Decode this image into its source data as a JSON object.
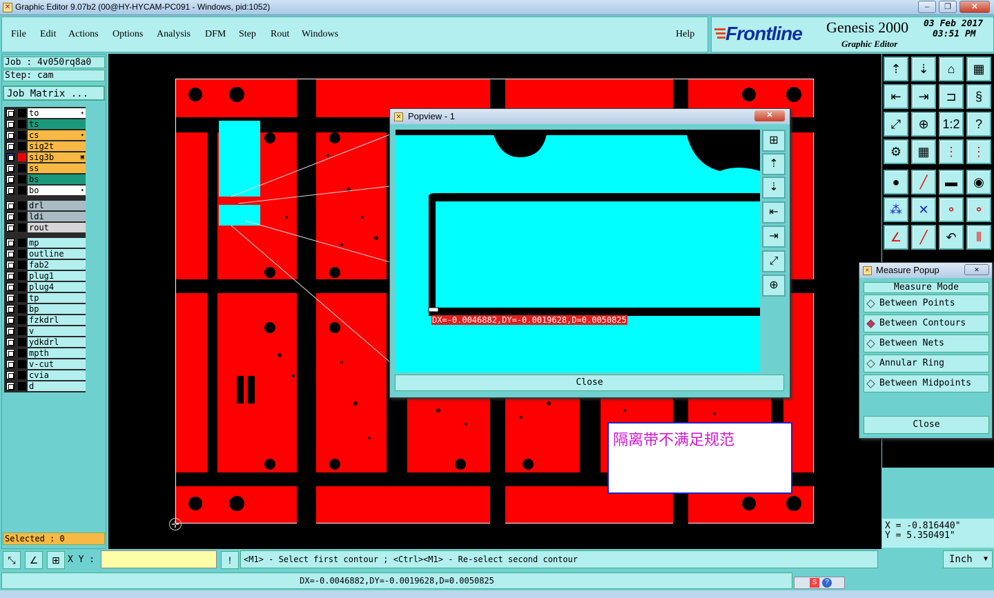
{
  "window": {
    "title": "Graphic Editor 9.07b2 (00@HY-HYCAM-PC091 - Windows, pid:1052)"
  },
  "menu": {
    "items": [
      "File",
      "Edit",
      "Actions",
      "Options",
      "Analysis",
      "DFM",
      "Step",
      "Rout",
      "Windows"
    ],
    "help": "Help"
  },
  "brand": {
    "logo": "Frontline",
    "product": "Genesis 2000",
    "subtitle": "Graphic Editor",
    "date": "03 Feb 2017",
    "time": "03:51 PM"
  },
  "job": {
    "job_label": "Job : 4v050rq8a0",
    "step_label": "Step: cam",
    "matrix_button": "Job Matrix ..."
  },
  "layers": [
    {
      "name": "to",
      "color": "#ffffff",
      "mark": "✦"
    },
    {
      "name": "ts",
      "color": "#1a9a7a",
      "mark": ""
    },
    {
      "name": "cs",
      "color": "#f7b944",
      "mark": "✦"
    },
    {
      "name": "sig2t",
      "color": "#f7b944",
      "mark": ""
    },
    {
      "name": "sig3b",
      "color": "#f7b944",
      "mark": "▣",
      "active": true
    },
    {
      "name": "ss",
      "color": "#f7b944",
      "mark": ""
    },
    {
      "name": "bs",
      "color": "#1a9a7a",
      "mark": ""
    },
    {
      "name": "bo",
      "color": "#ffffff",
      "mark": "✦"
    },
    {
      "name": "drl",
      "color": "#a9bcc4",
      "mark": ""
    },
    {
      "name": "ldi",
      "color": "#a9bcc4",
      "mark": ""
    },
    {
      "name": "rout",
      "color": "#d6d6d6",
      "mark": ""
    },
    {
      "name": "mp",
      "color": "#b3efef",
      "mark": ""
    },
    {
      "name": "outline",
      "color": "#b3efef",
      "mark": ""
    },
    {
      "name": "fab2",
      "color": "#b3efef",
      "mark": ""
    },
    {
      "name": "plug1",
      "color": "#b3efef",
      "mark": ""
    },
    {
      "name": "plug4",
      "color": "#b3efef",
      "mark": ""
    },
    {
      "name": "tp",
      "color": "#b3efef",
      "mark": ""
    },
    {
      "name": "bp",
      "color": "#b3efef",
      "mark": ""
    },
    {
      "name": "fzkdrl",
      "color": "#b3efef",
      "mark": ""
    },
    {
      "name": "v",
      "color": "#b3efef",
      "mark": ""
    },
    {
      "name": "ydkdrl",
      "color": "#b3efef",
      "mark": ""
    },
    {
      "name": "mpth",
      "color": "#b3efef",
      "mark": ""
    },
    {
      "name": "v-cut",
      "color": "#b3efef",
      "mark": ""
    },
    {
      "name": "cvia",
      "color": "#b3efef",
      "mark": ""
    },
    {
      "name": "d",
      "color": "#b3efef",
      "mark": ""
    }
  ],
  "selected": "Selected : 0",
  "popview": {
    "title": "Popview - 1",
    "measurement": "DX=-0.0046882,DY=-0.0019628,D=0.0050825",
    "close": "Close"
  },
  "measure_popup": {
    "title": "Measure Popup",
    "mode_header": "Measure Mode",
    "modes": [
      "Between Points",
      "Between Contours",
      "Between Nets",
      "Annular Ring",
      "Between Midpoints"
    ],
    "selected_mode": "Between Contours",
    "close": "Close"
  },
  "annotation": {
    "text": "隔离带不满足规范",
    "color": "#d018d0"
  },
  "coords": {
    "x": "X = -0.816440\"",
    "y": "Y = 5.350491\""
  },
  "command": {
    "xy_label": "X Y :",
    "prompt": "<M1> - Select first contour ; <Ctrl><M1> - Re-select second contour",
    "unit": "Inch"
  },
  "status": "DX=-0.0046882,DY=-0.0019628,D=0.0050825",
  "colors": {
    "board": "#ff0000",
    "copper_highlight": "#00ffff",
    "panel": "#6fd1cf",
    "button": "#b3efef"
  }
}
